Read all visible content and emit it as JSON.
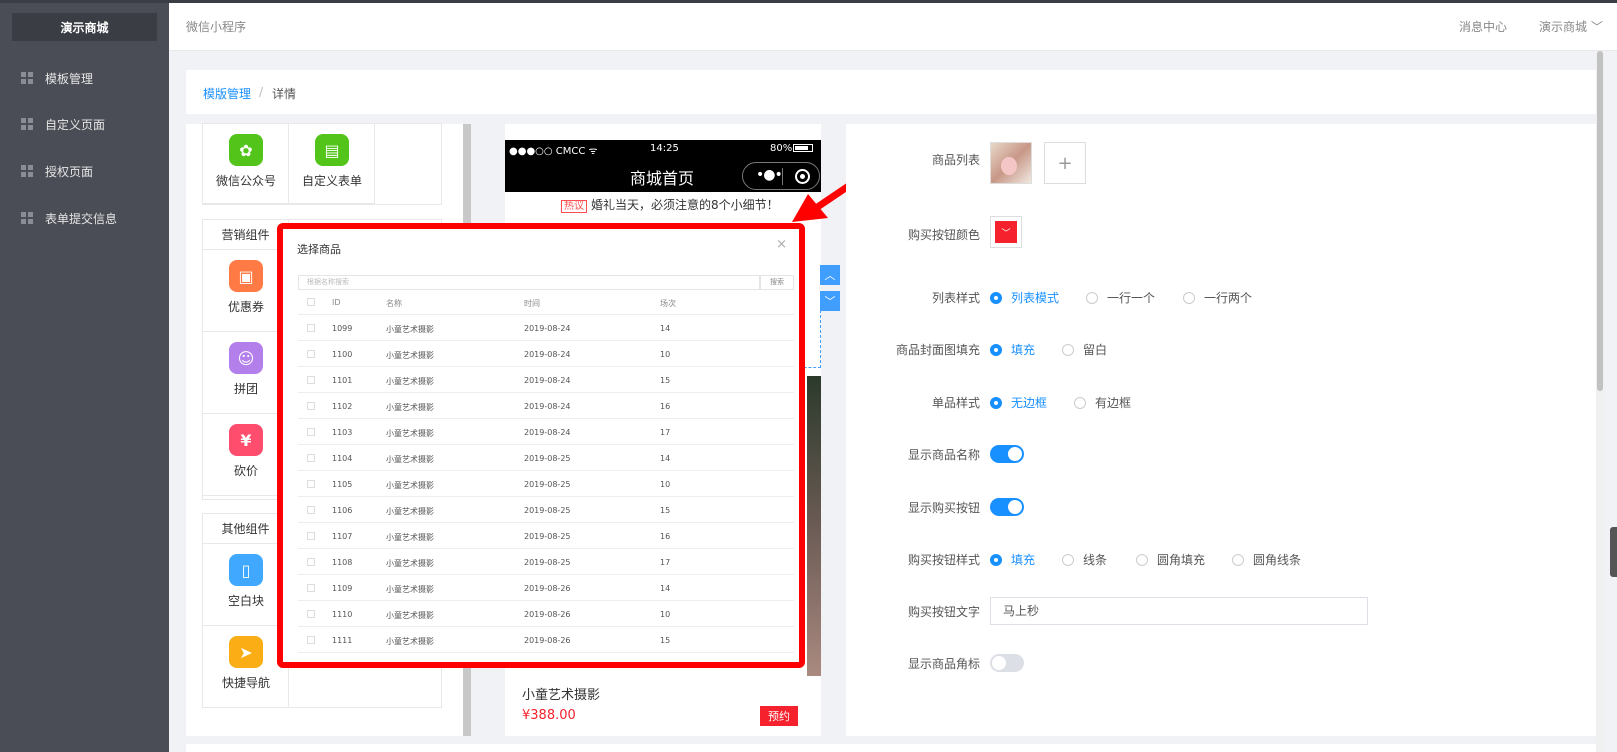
{
  "brand": "演示商城",
  "sidebar": {
    "items": [
      {
        "label": "模板管理"
      },
      {
        "label": "自定义页面"
      },
      {
        "label": "授权页面"
      },
      {
        "label": "表单提交信息"
      }
    ]
  },
  "header": {
    "app_title": "微信小程序",
    "message_center": "消息中心",
    "shop_menu": "演示商城 ﹀"
  },
  "breadcrumb": {
    "parent": "模版管理",
    "separator": "/",
    "current": "详情"
  },
  "components": {
    "basic": [
      {
        "label": "微信公众号",
        "icon": "wechat-icon",
        "color": "#52c41a",
        "glyph": "✿"
      },
      {
        "label": "自定义表单",
        "icon": "form-icon",
        "color": "#52c41a",
        "glyph": "▤"
      }
    ],
    "marketing_title": "营销组件",
    "marketing": [
      {
        "label": "优惠券",
        "icon": "coupon-icon",
        "color": "#ff7a45",
        "glyph": "▣"
      },
      {
        "label": "拼团",
        "icon": "group-buy-icon",
        "color": "#b37feb",
        "glyph": "☺"
      },
      {
        "label": "砍价",
        "icon": "bargain-icon",
        "color": "#ff4d6d",
        "glyph": "¥"
      }
    ],
    "other_title": "其他组件",
    "other": [
      {
        "label": "空白块",
        "icon": "blank-block-icon",
        "color": "#40a9ff",
        "glyph": "▯"
      },
      {
        "label": "快捷导航",
        "icon": "quick-nav-icon",
        "color": "#faad14",
        "glyph": "➤"
      }
    ]
  },
  "phone": {
    "carrier": "●●●○○ CMCC ᯤ",
    "time": "14:25",
    "battery": "80%",
    "title": "商城首页",
    "capsule_dots": "•●•",
    "hot_tag": "热议",
    "hot_text": "婚礼当天，必须注意的8个小细节！",
    "product_name": "小童艺术摄影",
    "product_price": "¥388.00",
    "book_label": "预约"
  },
  "modal": {
    "title": "选择商品",
    "close": "×",
    "search_placeholder": "根据名称搜索",
    "search_button": "搜索",
    "columns": [
      "ID",
      "名称",
      "时间",
      "场次"
    ],
    "rows": [
      {
        "id": "1099",
        "name": "小童艺术摄影",
        "time": "2019-08-24",
        "sessions": "14"
      },
      {
        "id": "1100",
        "name": "小童艺术摄影",
        "time": "2019-08-24",
        "sessions": "10"
      },
      {
        "id": "1101",
        "name": "小童艺术摄影",
        "time": "2019-08-24",
        "sessions": "15"
      },
      {
        "id": "1102",
        "name": "小童艺术摄影",
        "time": "2019-08-24",
        "sessions": "16"
      },
      {
        "id": "1103",
        "name": "小童艺术摄影",
        "time": "2019-08-24",
        "sessions": "17"
      },
      {
        "id": "1104",
        "name": "小童艺术摄影",
        "time": "2019-08-25",
        "sessions": "14"
      },
      {
        "id": "1105",
        "name": "小童艺术摄影",
        "time": "2019-08-25",
        "sessions": "10"
      },
      {
        "id": "1106",
        "name": "小童艺术摄影",
        "time": "2019-08-25",
        "sessions": "15"
      },
      {
        "id": "1107",
        "name": "小童艺术摄影",
        "time": "2019-08-25",
        "sessions": "16"
      },
      {
        "id": "1108",
        "name": "小童艺术摄影",
        "time": "2019-08-25",
        "sessions": "17"
      },
      {
        "id": "1109",
        "name": "小童艺术摄影",
        "time": "2019-08-26",
        "sessions": "14"
      },
      {
        "id": "1110",
        "name": "小童艺术摄影",
        "time": "2019-08-26",
        "sessions": "10"
      },
      {
        "id": "1111",
        "name": "小童艺术摄影",
        "time": "2019-08-26",
        "sessions": "15"
      }
    ]
  },
  "settings": {
    "product_list_label": "商品列表",
    "add_symbol": "+",
    "buy_color_label": "购买按钮颜色",
    "buy_color": "#f5222d",
    "list_style_label": "列表样式",
    "list_style_options": [
      "列表模式",
      "一行一个",
      "一行两个"
    ],
    "cover_fill_label": "商品封面图填充",
    "cover_fill_options": [
      "填充",
      "留白"
    ],
    "item_style_label": "单品样式",
    "item_style_options": [
      "无边框",
      "有边框"
    ],
    "show_name_label": "显示商品名称",
    "show_buy_label": "显示购买按钮",
    "buy_style_label": "购买按钮样式",
    "buy_style_options": [
      "填充",
      "线条",
      "圆角填充",
      "圆角线条"
    ],
    "buy_text_label": "购买按钮文字",
    "buy_text_value": "马上秒",
    "show_corner_label": "显示商品角标"
  },
  "accent_color": "#1890ff",
  "highlight_color": "#ff0000"
}
